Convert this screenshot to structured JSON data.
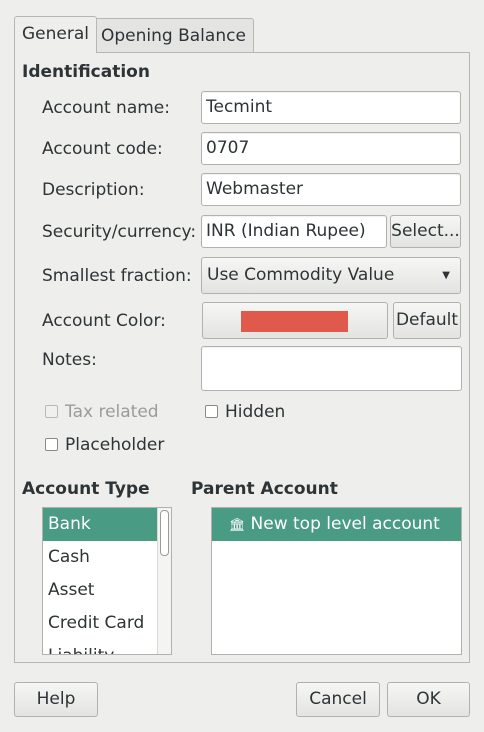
{
  "tabs": [
    {
      "label": "General",
      "active": true
    },
    {
      "label": "Opening Balance",
      "active": false
    }
  ],
  "identification": {
    "title": "Identification",
    "account_name_label": "Account name:",
    "account_name_value": "Tecmint",
    "account_code_label": "Account code:",
    "account_code_value": "0707",
    "description_label": "Description:",
    "description_value": "Webmaster",
    "currency_label": "Security/currency:",
    "currency_value": "INR (Indian Rupee)",
    "select_button": "Select...",
    "fraction_label": "Smallest fraction:",
    "fraction_value": "Use Commodity Value",
    "color_label": "Account Color:",
    "color_swatch": "#e05a4b",
    "default_button": "Default",
    "notes_label": "Notes:",
    "notes_value": ""
  },
  "options": {
    "tax_related": {
      "label": "Tax related",
      "checked": false,
      "disabled": true
    },
    "hidden": {
      "label": "Hidden",
      "checked": false
    },
    "placeholder": {
      "label": "Placeholder",
      "checked": false
    }
  },
  "account_type": {
    "title": "Account Type",
    "items": [
      "Bank",
      "Cash",
      "Asset",
      "Credit Card",
      "Liability"
    ],
    "selected": "Bank"
  },
  "parent_account": {
    "title": "Parent Account",
    "items": [
      {
        "label": "New top level account",
        "icon": "bank-icon",
        "selected": true
      }
    ]
  },
  "buttons": {
    "help": "Help",
    "cancel": "Cancel",
    "ok": "OK"
  },
  "colors": {
    "selection": "#4a9b83",
    "background": "#eeeeec"
  }
}
